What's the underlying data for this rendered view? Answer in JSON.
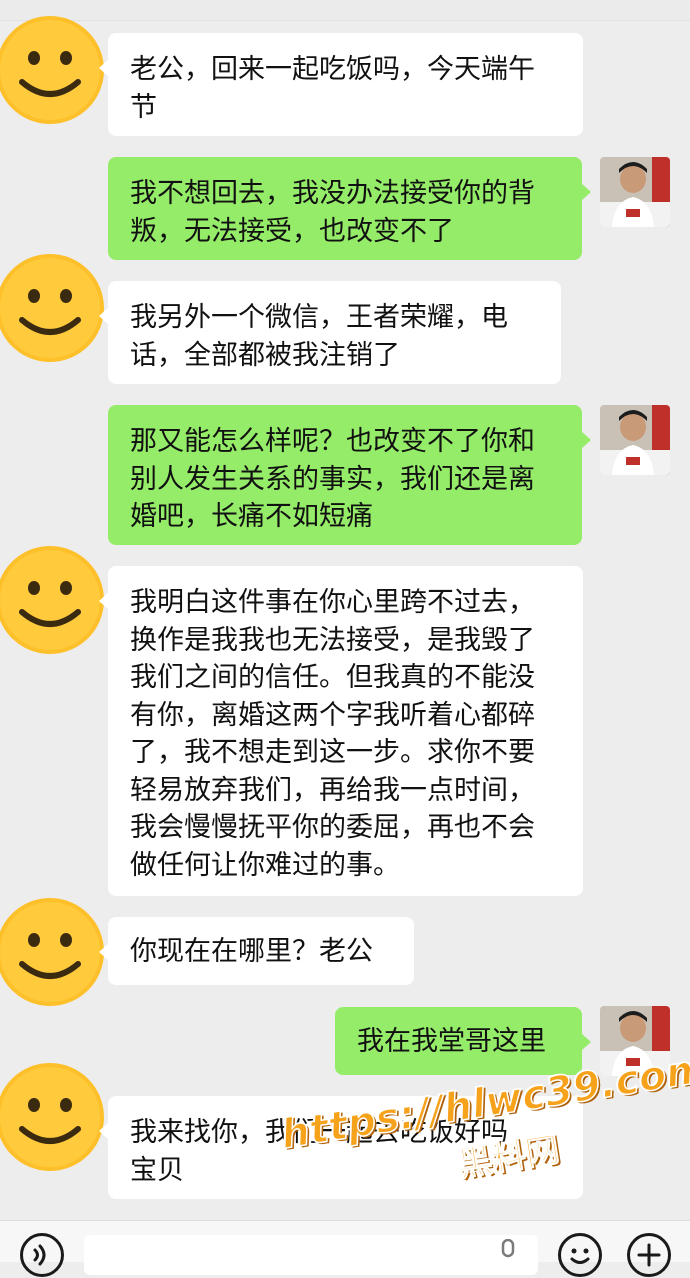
{
  "conversation": {
    "messages": [
      {
        "side": "left",
        "text": "老公，回来一起吃饭吗，今天端午\n节"
      },
      {
        "side": "right",
        "text": "我不想回去，我没办法接受你的背\n叛，无法接受，也改变不了"
      },
      {
        "side": "left",
        "text": "我另外一个微信，王者荣耀，电\n话，全部都被我注销了"
      },
      {
        "side": "right",
        "text": "那又能怎么样呢？也改变不了你和\n别人发生关系的事实，我们还是离\n婚吧，长痛不如短痛"
      },
      {
        "side": "left",
        "text": "我明白这件事在你心里跨不过去，\n换作是我我也无法接受，是我毁了\n我们之间的信任。但我真的不能没\n有你，离婚这两个字我听着心都碎\n了，我不想走到这一步。求你不要\n轻易放弃我们，再给我一点时间，\n我会慢慢抚平你的委屈，再也不会\n做任何让你难过的事。"
      },
      {
        "side": "left",
        "text": "你现在在哪里？老公"
      },
      {
        "side": "right",
        "text": "我在我堂哥这里"
      },
      {
        "side": "left",
        "text": "我来找你，我们一起去吃饭好吗\n宝贝"
      }
    ]
  },
  "avatars": {
    "left": "smiley-face-emoji-icon",
    "right": "user-photo-avatar"
  },
  "watermark": {
    "url": "https://hlwc39.com",
    "site_name": "黑料网"
  },
  "input_bar": {
    "voice_icon": "voice-icon",
    "emoji_icon": "emoji-icon",
    "add_icon": "plus-icon",
    "input_value": ""
  },
  "colors": {
    "background": "#ededed",
    "outgoing_bubble": "#95ec69",
    "incoming_bubble": "#ffffff",
    "watermark": "#f7a21b"
  }
}
